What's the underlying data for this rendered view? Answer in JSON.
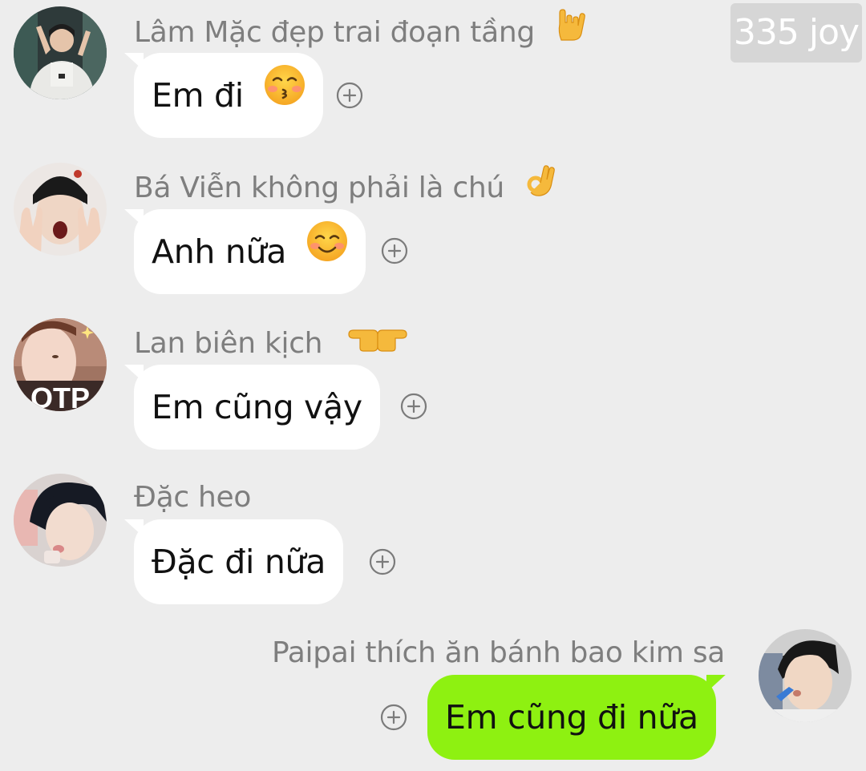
{
  "watermark": {
    "text": "335 joy"
  },
  "messages": [
    {
      "sender": "Lâm Mặc đẹp trai đoạn tầng",
      "sender_icon": "rock-on-hand-icon",
      "text": "Em đi",
      "text_icon": "kissing-face-icon",
      "direction": "incoming"
    },
    {
      "sender": "Bá Viễn không phải là chú",
      "sender_icon": "ok-hand-icon",
      "text": "Anh nữa",
      "text_icon": "smiling-blush-face-icon",
      "direction": "incoming"
    },
    {
      "sender": "Lan biên kịch",
      "sender_icon": "pointing-hands-icon",
      "text": "Em cũng vậy",
      "text_icon": "",
      "direction": "incoming"
    },
    {
      "sender": "Đặc heo",
      "sender_icon": "",
      "text": "Đặc đi nữa",
      "text_icon": "",
      "direction": "incoming"
    },
    {
      "sender": "Paipai thích ăn bánh bao kim sa",
      "sender_icon": "",
      "text": "Em cũng đi nữa",
      "text_icon": "",
      "direction": "outgoing"
    }
  ],
  "avatar_partial_text": "OTP",
  "colors": {
    "background": "#ededed",
    "incoming_bubble": "#ffffff",
    "outgoing_bubble": "#8ef111",
    "sender_text": "#7e7e7e",
    "message_text": "#111111"
  }
}
